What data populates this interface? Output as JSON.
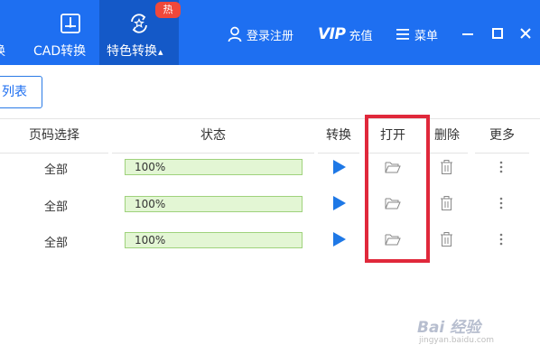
{
  "nav": {
    "partial_label": "换",
    "cad_label": "CAD转换",
    "special_label": "特色转换",
    "special_caret": "▴",
    "hot_badge": "热"
  },
  "header_actions": {
    "login_label": "登录注册",
    "vip_mark": "VIP",
    "vip_label": "充值",
    "menu_label": "菜单"
  },
  "toolbar": {
    "list_label": "列表"
  },
  "table": {
    "columns": {
      "pages": "页码选择",
      "status": "状态",
      "convert": "转换",
      "open": "打开",
      "delete": "删除",
      "more": "更多"
    },
    "rows": [
      {
        "pages": "全部",
        "progress": "100%"
      },
      {
        "pages": "全部",
        "progress": "100%"
      },
      {
        "pages": "全部",
        "progress": "100%"
      }
    ]
  },
  "watermark": {
    "logo": "Bai 经验",
    "url": "jingyan.baidu.com"
  },
  "colors": {
    "topbar": "#1e6ff1",
    "active_tab": "#1459c8",
    "hot_badge": "#f0483a",
    "progress_fill": "#e3f6d4",
    "progress_border": "#9fd27c",
    "play": "#1e78e6",
    "highlight": "#e0283b"
  }
}
